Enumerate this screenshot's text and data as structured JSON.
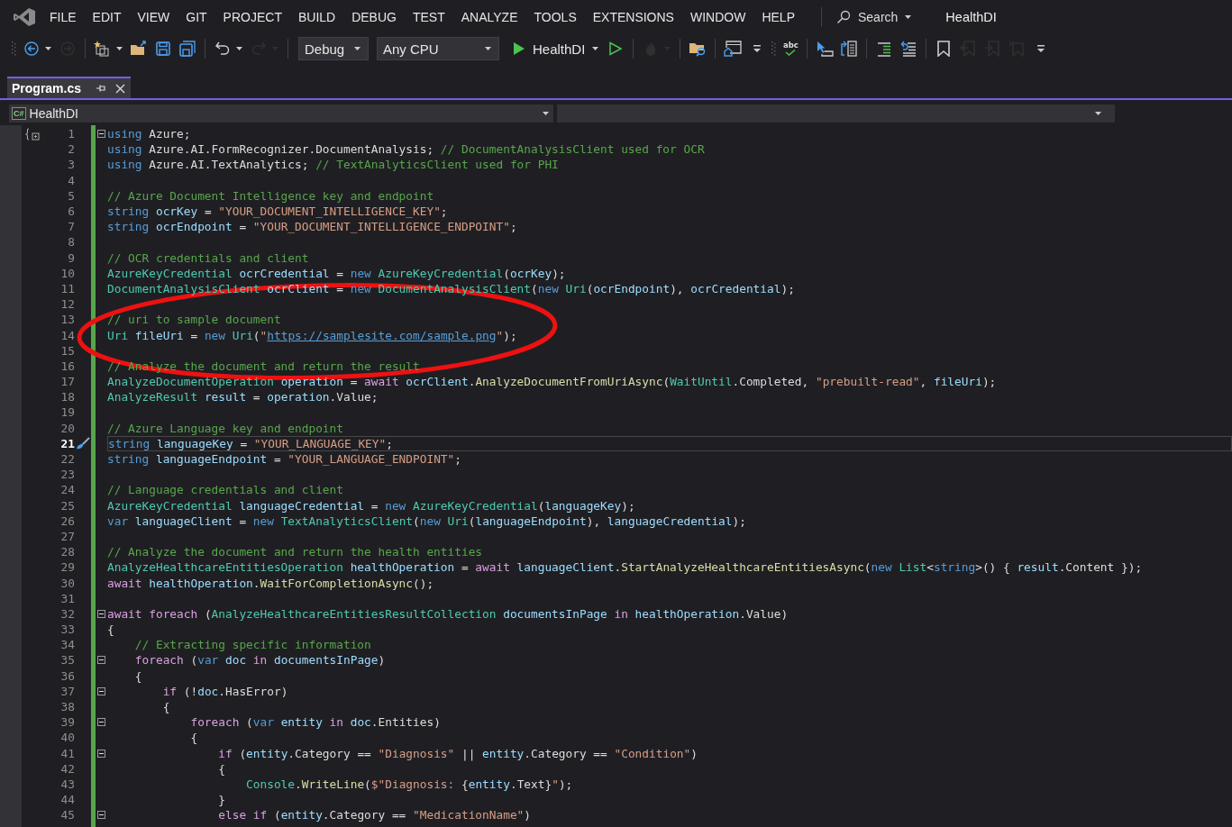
{
  "menu_bar": {
    "items": [
      "FILE",
      "EDIT",
      "VIEW",
      "GIT",
      "PROJECT",
      "BUILD",
      "DEBUG",
      "TEST",
      "ANALYZE",
      "TOOLS",
      "EXTENSIONS",
      "WINDOW",
      "HELP"
    ],
    "search": "Search",
    "solution_title": "HealthDI"
  },
  "toolbar": {
    "items": [
      {
        "kind": "grip"
      },
      {
        "kind": "back",
        "disabled": false
      },
      {
        "kind": "caret",
        "disabled": false
      },
      {
        "kind": "forward",
        "disabled": true
      },
      {
        "kind": "sep"
      },
      {
        "kind": "new_item",
        "disabled": false
      },
      {
        "kind": "caret",
        "disabled": false
      },
      {
        "kind": "open",
        "disabled": false
      },
      {
        "kind": "save",
        "disabled": false
      },
      {
        "kind": "save_all",
        "disabled": false
      },
      {
        "kind": "sep"
      },
      {
        "kind": "undo",
        "disabled": false
      },
      {
        "kind": "caret",
        "disabled": false
      },
      {
        "kind": "redo",
        "disabled": true
      },
      {
        "kind": "caret",
        "disabled": true
      },
      {
        "kind": "sep"
      },
      {
        "kind": "dropdown",
        "label": "Debug",
        "disabled": false
      },
      {
        "kind": "dropdown",
        "label": "Any CPU",
        "disabled": false
      },
      {
        "kind": "run",
        "label": "HealthDI",
        "disabled": false
      },
      {
        "kind": "run_nodebug",
        "disabled": false
      },
      {
        "kind": "sep"
      },
      {
        "kind": "hot_reload",
        "disabled": true
      },
      {
        "kind": "caret",
        "disabled": true
      },
      {
        "kind": "sep"
      },
      {
        "kind": "folder_search",
        "disabled": false
      },
      {
        "kind": "sep"
      },
      {
        "kind": "browser",
        "disabled": false
      },
      {
        "kind": "overflow",
        "disabled": false
      },
      {
        "kind": "grip"
      },
      {
        "kind": "spellcheck",
        "label": "abc",
        "disabled": false
      },
      {
        "kind": "sep"
      },
      {
        "kind": "pointer",
        "disabled": false
      },
      {
        "kind": "swap",
        "disabled": false
      },
      {
        "kind": "sep"
      },
      {
        "kind": "indent",
        "disabled": false
      },
      {
        "kind": "outdent",
        "disabled": false
      },
      {
        "kind": "sep"
      },
      {
        "kind": "bookmark",
        "disabled": false
      },
      {
        "kind": "bookmark_prev",
        "disabled": true
      },
      {
        "kind": "bookmark_next",
        "disabled": true
      },
      {
        "kind": "bookmark_clear",
        "disabled": true
      },
      {
        "kind": "overflow",
        "disabled": false
      }
    ]
  },
  "tabs": [
    {
      "label": "Program.cs",
      "selected": true
    }
  ],
  "nav_bar": {
    "language_badge": "C#",
    "project": "HealthDI"
  },
  "editor": {
    "annotations": [
      {
        "kind": "ellipse"
      }
    ],
    "lines": [
      {
        "number": "1",
        "fold": true,
        "current": false,
        "tokens": [
          {
            "text": "using",
            "kind": "kw"
          },
          {
            "text": " Azure;",
            "kind": "txt"
          }
        ]
      },
      {
        "number": "2",
        "fold": false,
        "current": false,
        "tokens": [
          {
            "text": "using",
            "kind": "kw"
          },
          {
            "text": " Azure.AI.FormRecognizer.DocumentAnalysis; ",
            "kind": "txt"
          },
          {
            "text": "// DocumentAnalysisClient used for OCR",
            "kind": "cmt"
          }
        ]
      },
      {
        "number": "3",
        "fold": false,
        "current": false,
        "tokens": [
          {
            "text": "using",
            "kind": "kw"
          },
          {
            "text": " Azure.AI.TextAnalytics; ",
            "kind": "txt"
          },
          {
            "text": "// TextAnalyticsClient used for PHI",
            "kind": "cmt"
          }
        ]
      },
      {
        "number": "4",
        "fold": false,
        "current": false
      },
      {
        "number": "5",
        "fold": false,
        "current": false,
        "tokens": [
          {
            "text": "// Azure Document Intelligence key and endpoint",
            "kind": "cmt"
          }
        ]
      },
      {
        "number": "6",
        "fold": false,
        "current": false,
        "tokens": [
          {
            "text": "string ",
            "kind": "kw"
          },
          {
            "text": "ocrKey",
            "kind": "var"
          },
          {
            "text": " = ",
            "kind": "txt"
          },
          {
            "text": "\"YOUR_DOCUMENT_INTELLIGENCE_KEY\"",
            "kind": "str"
          },
          {
            "text": ";",
            "kind": "txt"
          }
        ]
      },
      {
        "number": "7",
        "fold": false,
        "current": false,
        "tokens": [
          {
            "text": "string ",
            "kind": "kw"
          },
          {
            "text": "ocrEndpoint",
            "kind": "var"
          },
          {
            "text": " = ",
            "kind": "txt"
          },
          {
            "text": "\"YOUR_DOCUMENT_INTELLIGENCE_ENDPOINT\"",
            "kind": "str"
          },
          {
            "text": ";",
            "kind": "txt"
          }
        ]
      },
      {
        "number": "8",
        "fold": false,
        "current": false
      },
      {
        "number": "9",
        "fold": false,
        "current": false,
        "tokens": [
          {
            "text": "// OCR credentials and client",
            "kind": "cmt"
          }
        ]
      },
      {
        "number": "10",
        "fold": false,
        "current": false,
        "tokens": [
          {
            "text": "AzureKeyCredential ",
            "kind": "type"
          },
          {
            "text": "ocrCredential",
            "kind": "var"
          },
          {
            "text": " = ",
            "kind": "txt"
          },
          {
            "text": "new ",
            "kind": "kw"
          },
          {
            "text": "AzureKeyCredential",
            "kind": "type"
          },
          {
            "text": "(",
            "kind": "txt"
          },
          {
            "text": "ocrKey",
            "kind": "var"
          },
          {
            "text": ");",
            "kind": "txt"
          }
        ]
      },
      {
        "number": "11",
        "fold": false,
        "current": false,
        "tokens": [
          {
            "text": "DocumentAnalysisClient ",
            "kind": "type"
          },
          {
            "text": "ocrClient",
            "kind": "var"
          },
          {
            "text": " = ",
            "kind": "txt"
          },
          {
            "text": "new ",
            "kind": "kw"
          },
          {
            "text": "DocumentAnalysisClient",
            "kind": "type"
          },
          {
            "text": "(",
            "kind": "txt"
          },
          {
            "text": "new ",
            "kind": "kw"
          },
          {
            "text": "Uri",
            "kind": "type"
          },
          {
            "text": "(",
            "kind": "txt"
          },
          {
            "text": "ocrEndpoint",
            "kind": "var"
          },
          {
            "text": "), ",
            "kind": "txt"
          },
          {
            "text": "ocrCredential",
            "kind": "var"
          },
          {
            "text": ");",
            "kind": "txt"
          }
        ]
      },
      {
        "number": "12",
        "fold": false,
        "current": false
      },
      {
        "number": "13",
        "fold": false,
        "current": false,
        "tokens": [
          {
            "text": "// uri to sample document",
            "kind": "cmt"
          }
        ]
      },
      {
        "number": "14",
        "fold": false,
        "current": false,
        "tokens": [
          {
            "text": "Uri ",
            "kind": "type"
          },
          {
            "text": "fileUri",
            "kind": "var"
          },
          {
            "text": " = ",
            "kind": "txt"
          },
          {
            "text": "new ",
            "kind": "kw"
          },
          {
            "text": "Uri",
            "kind": "type"
          },
          {
            "text": "(",
            "kind": "txt"
          },
          {
            "text": "\"",
            "kind": "str"
          },
          {
            "text": "https://samplesite.com/sample.png",
            "kind": "url"
          },
          {
            "text": "\"",
            "kind": "str"
          },
          {
            "text": ");",
            "kind": "txt"
          }
        ]
      },
      {
        "number": "15",
        "fold": false,
        "current": false
      },
      {
        "number": "16",
        "fold": false,
        "current": false,
        "tokens": [
          {
            "text": "// Analyze the document and return the result",
            "kind": "cmt"
          }
        ]
      },
      {
        "number": "17",
        "fold": false,
        "current": false,
        "tokens": [
          {
            "text": "AnalyzeDocumentOperation ",
            "kind": "type"
          },
          {
            "text": "operation",
            "kind": "var"
          },
          {
            "text": " = ",
            "kind": "txt"
          },
          {
            "text": "await ",
            "kind": "ctl"
          },
          {
            "text": "ocrClient",
            "kind": "var"
          },
          {
            "text": ".",
            "kind": "txt"
          },
          {
            "text": "AnalyzeDocumentFromUriAsync",
            "kind": "fn"
          },
          {
            "text": "(",
            "kind": "txt"
          },
          {
            "text": "WaitUntil",
            "kind": "type"
          },
          {
            "text": ".Completed, ",
            "kind": "txt"
          },
          {
            "text": "\"prebuilt-read\"",
            "kind": "str"
          },
          {
            "text": ", ",
            "kind": "txt"
          },
          {
            "text": "fileUri",
            "kind": "var"
          },
          {
            "text": ");",
            "kind": "txt"
          }
        ]
      },
      {
        "number": "18",
        "fold": false,
        "current": false,
        "tokens": [
          {
            "text": "AnalyzeResult ",
            "kind": "type"
          },
          {
            "text": "result",
            "kind": "var"
          },
          {
            "text": " = ",
            "kind": "txt"
          },
          {
            "text": "operation",
            "kind": "var"
          },
          {
            "text": ".Value;",
            "kind": "txt"
          }
        ]
      },
      {
        "number": "19",
        "fold": false,
        "current": false
      },
      {
        "number": "20",
        "fold": false,
        "current": false,
        "tokens": [
          {
            "text": "// Azure Language key and endpoint",
            "kind": "cmt"
          }
        ]
      },
      {
        "number": "21",
        "fold": false,
        "current": true,
        "tokens": [
          {
            "text": "string ",
            "kind": "kw"
          },
          {
            "text": "languageKey",
            "kind": "var"
          },
          {
            "text": " = ",
            "kind": "txt"
          },
          {
            "text": "\"YOUR_LANGUAGE_KEY\"",
            "kind": "str"
          },
          {
            "text": ";",
            "kind": "txt"
          }
        ]
      },
      {
        "number": "22",
        "fold": false,
        "current": false,
        "tokens": [
          {
            "text": "string ",
            "kind": "kw"
          },
          {
            "text": "languageEndpoint",
            "kind": "var"
          },
          {
            "text": " = ",
            "kind": "txt"
          },
          {
            "text": "\"YOUR_LANGUAGE_ENDPOINT\"",
            "kind": "str"
          },
          {
            "text": ";",
            "kind": "txt"
          }
        ]
      },
      {
        "number": "23",
        "fold": false,
        "current": false
      },
      {
        "number": "24",
        "fold": false,
        "current": false,
        "tokens": [
          {
            "text": "// Language credentials and client",
            "kind": "cmt"
          }
        ]
      },
      {
        "number": "25",
        "fold": false,
        "current": false,
        "tokens": [
          {
            "text": "AzureKeyCredential ",
            "kind": "type"
          },
          {
            "text": "languageCredential",
            "kind": "var"
          },
          {
            "text": " = ",
            "kind": "txt"
          },
          {
            "text": "new ",
            "kind": "kw"
          },
          {
            "text": "AzureKeyCredential",
            "kind": "type"
          },
          {
            "text": "(",
            "kind": "txt"
          },
          {
            "text": "languageKey",
            "kind": "var"
          },
          {
            "text": ");",
            "kind": "txt"
          }
        ]
      },
      {
        "number": "26",
        "fold": false,
        "current": false,
        "tokens": [
          {
            "text": "var ",
            "kind": "kw"
          },
          {
            "text": "languageClient",
            "kind": "var"
          },
          {
            "text": " = ",
            "kind": "txt"
          },
          {
            "text": "new ",
            "kind": "kw"
          },
          {
            "text": "TextAnalyticsClient",
            "kind": "type"
          },
          {
            "text": "(",
            "kind": "txt"
          },
          {
            "text": "new ",
            "kind": "kw"
          },
          {
            "text": "Uri",
            "kind": "type"
          },
          {
            "text": "(",
            "kind": "txt"
          },
          {
            "text": "languageEndpoint",
            "kind": "var"
          },
          {
            "text": "), ",
            "kind": "txt"
          },
          {
            "text": "languageCredential",
            "kind": "var"
          },
          {
            "text": ");",
            "kind": "txt"
          }
        ]
      },
      {
        "number": "27",
        "fold": false,
        "current": false
      },
      {
        "number": "28",
        "fold": false,
        "current": false,
        "tokens": [
          {
            "text": "// Analyze the document and return the health entities",
            "kind": "cmt"
          }
        ]
      },
      {
        "number": "29",
        "fold": false,
        "current": false,
        "tokens": [
          {
            "text": "AnalyzeHealthcareEntitiesOperation ",
            "kind": "type"
          },
          {
            "text": "healthOperation",
            "kind": "var"
          },
          {
            "text": " = ",
            "kind": "txt"
          },
          {
            "text": "await ",
            "kind": "ctl"
          },
          {
            "text": "languageClient",
            "kind": "var"
          },
          {
            "text": ".",
            "kind": "txt"
          },
          {
            "text": "StartAnalyzeHealthcareEntitiesAsync",
            "kind": "fn"
          },
          {
            "text": "(",
            "kind": "txt"
          },
          {
            "text": "new ",
            "kind": "kw"
          },
          {
            "text": "List",
            "kind": "type"
          },
          {
            "text": "<",
            "kind": "txt"
          },
          {
            "text": "string",
            "kind": "kw"
          },
          {
            "text": ">() { ",
            "kind": "txt"
          },
          {
            "text": "result",
            "kind": "var"
          },
          {
            "text": ".Content });",
            "kind": "txt"
          }
        ]
      },
      {
        "number": "30",
        "fold": false,
        "current": false,
        "tokens": [
          {
            "text": "await ",
            "kind": "ctl"
          },
          {
            "text": "healthOperation",
            "kind": "var"
          },
          {
            "text": ".",
            "kind": "txt"
          },
          {
            "text": "WaitForCompletionAsync",
            "kind": "fn"
          },
          {
            "text": "();",
            "kind": "txt"
          }
        ]
      },
      {
        "number": "31",
        "fold": false,
        "current": false
      },
      {
        "number": "32",
        "fold": true,
        "current": false,
        "tokens": [
          {
            "text": "await foreach",
            "kind": "ctl"
          },
          {
            "text": " (",
            "kind": "txt"
          },
          {
            "text": "AnalyzeHealthcareEntitiesResultCollection ",
            "kind": "type"
          },
          {
            "text": "documentsInPage ",
            "kind": "var"
          },
          {
            "text": "in ",
            "kind": "ctl"
          },
          {
            "text": "healthOperation",
            "kind": "var"
          },
          {
            "text": ".Value)",
            "kind": "txt"
          }
        ]
      },
      {
        "number": "33",
        "fold": false,
        "current": false,
        "tokens": [
          {
            "text": "{",
            "kind": "txt"
          }
        ]
      },
      {
        "number": "34",
        "fold": false,
        "current": false,
        "tokens": [
          {
            "text": "    // Extracting specific information",
            "kind": "cmt"
          }
        ]
      },
      {
        "number": "35",
        "fold": true,
        "current": false,
        "tokens": [
          {
            "text": "    foreach",
            "kind": "ctl"
          },
          {
            "text": " (",
            "kind": "txt"
          },
          {
            "text": "var ",
            "kind": "kw"
          },
          {
            "text": "doc ",
            "kind": "var"
          },
          {
            "text": "in ",
            "kind": "ctl"
          },
          {
            "text": "documentsInPage",
            "kind": "var"
          },
          {
            "text": ")",
            "kind": "txt"
          }
        ]
      },
      {
        "number": "36",
        "fold": false,
        "current": false,
        "tokens": [
          {
            "text": "    {",
            "kind": "txt"
          }
        ]
      },
      {
        "number": "37",
        "fold": true,
        "current": false,
        "tokens": [
          {
            "text": "        if",
            "kind": "ctl"
          },
          {
            "text": " (!",
            "kind": "txt"
          },
          {
            "text": "doc",
            "kind": "var"
          },
          {
            "text": ".HasError)",
            "kind": "txt"
          }
        ]
      },
      {
        "number": "38",
        "fold": false,
        "current": false,
        "tokens": [
          {
            "text": "        {",
            "kind": "txt"
          }
        ]
      },
      {
        "number": "39",
        "fold": true,
        "current": false,
        "tokens": [
          {
            "text": "            foreach",
            "kind": "ctl"
          },
          {
            "text": " (",
            "kind": "txt"
          },
          {
            "text": "var ",
            "kind": "kw"
          },
          {
            "text": "entity ",
            "kind": "var"
          },
          {
            "text": "in ",
            "kind": "ctl"
          },
          {
            "text": "doc",
            "kind": "var"
          },
          {
            "text": ".Entities)",
            "kind": "txt"
          }
        ]
      },
      {
        "number": "40",
        "fold": false,
        "current": false,
        "tokens": [
          {
            "text": "            {",
            "kind": "txt"
          }
        ]
      },
      {
        "number": "41",
        "fold": true,
        "current": false,
        "tokens": [
          {
            "text": "                if",
            "kind": "ctl"
          },
          {
            "text": " (",
            "kind": "txt"
          },
          {
            "text": "entity",
            "kind": "var"
          },
          {
            "text": ".Category == ",
            "kind": "txt"
          },
          {
            "text": "\"Diagnosis\"",
            "kind": "str"
          },
          {
            "text": " || ",
            "kind": "txt"
          },
          {
            "text": "entity",
            "kind": "var"
          },
          {
            "text": ".Category == ",
            "kind": "txt"
          },
          {
            "text": "\"Condition\"",
            "kind": "str"
          },
          {
            "text": ")",
            "kind": "txt"
          }
        ]
      },
      {
        "number": "42",
        "fold": false,
        "current": false,
        "tokens": [
          {
            "text": "                {",
            "kind": "txt"
          }
        ]
      },
      {
        "number": "43",
        "fold": false,
        "current": false,
        "tokens": [
          {
            "text": "                    Console",
            "kind": "type"
          },
          {
            "text": ".",
            "kind": "txt"
          },
          {
            "text": "WriteLine",
            "kind": "fn"
          },
          {
            "text": "(",
            "kind": "txt"
          },
          {
            "text": "$\"Diagnosis: ",
            "kind": "str"
          },
          {
            "text": "{",
            "kind": "txt"
          },
          {
            "text": "entity",
            "kind": "var"
          },
          {
            "text": ".Text}",
            "kind": "txt"
          },
          {
            "text": "\"",
            "kind": "str"
          },
          {
            "text": ");",
            "kind": "txt"
          }
        ]
      },
      {
        "number": "44",
        "fold": false,
        "current": false,
        "tokens": [
          {
            "text": "                }",
            "kind": "txt"
          }
        ]
      },
      {
        "number": "45",
        "fold": true,
        "current": false,
        "tokens": [
          {
            "text": "                else if",
            "kind": "ctl"
          },
          {
            "text": " (",
            "kind": "txt"
          },
          {
            "text": "entity",
            "kind": "var"
          },
          {
            "text": ".Category == ",
            "kind": "txt"
          },
          {
            "text": "\"MedicationName\"",
            "kind": "str"
          },
          {
            "text": ")",
            "kind": "txt"
          }
        ]
      }
    ]
  }
}
